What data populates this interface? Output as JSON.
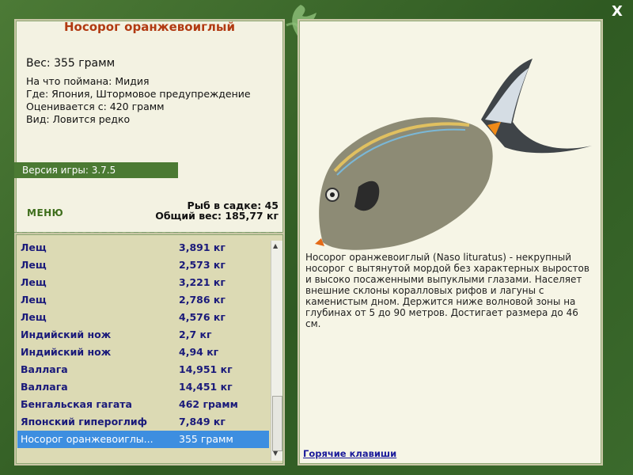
{
  "fish": {
    "name": "Носорог оранжевоиглый",
    "weight": "Вес: 355 грамм",
    "bait": "На что поймана: Мидия",
    "location": "Где: Япония, Штормовое предупреждение",
    "valued": "Оценивается с: 420 грамм",
    "kind": "Вид: Ловится редко"
  },
  "version": "Версия игры: 3.7.5",
  "menu_label": "МЕНЮ",
  "stats": {
    "count": "Рыб в садке: 45",
    "total": "Общий вес: 185,77 кг"
  },
  "catch_list": [
    {
      "name": "Лещ",
      "weight": "3,891 кг"
    },
    {
      "name": "Лещ",
      "weight": "2,573 кг"
    },
    {
      "name": "Лещ",
      "weight": "3,221 кг"
    },
    {
      "name": "Лещ",
      "weight": "2,786 кг"
    },
    {
      "name": "Лещ",
      "weight": "4,576 кг"
    },
    {
      "name": "Индийский нож",
      "weight": "2,7 кг"
    },
    {
      "name": "Индийский нож",
      "weight": "4,94 кг"
    },
    {
      "name": "Валлага",
      "weight": "14,951 кг"
    },
    {
      "name": "Валлага",
      "weight": "14,451 кг"
    },
    {
      "name": "Бенгальская гагата",
      "weight": "462 грамм"
    },
    {
      "name": "Японский гипероглиф",
      "weight": "7,849 кг"
    },
    {
      "name": "Носорог оранжевоиглы...",
      "weight": "355 грамм"
    }
  ],
  "description": "Носорог оранжевоиглый (Naso lituratus) - некрупный носорог с вытянутой мордой без характерных выростов и высоко посаженными выпуклыми глазами. Населяет внешние склоны коралловых рифов и лагуны с каменистым дном. Держится ниже волновой зоны на глубинах от 5 до 90 метров. Достигает размера до 46 см.",
  "hotkeys": "Горячие клавиши",
  "close_label": "X",
  "colors": {
    "accent": "#b13a12",
    "selected": "#3d8ee0",
    "frame": "#3d6a2c"
  }
}
